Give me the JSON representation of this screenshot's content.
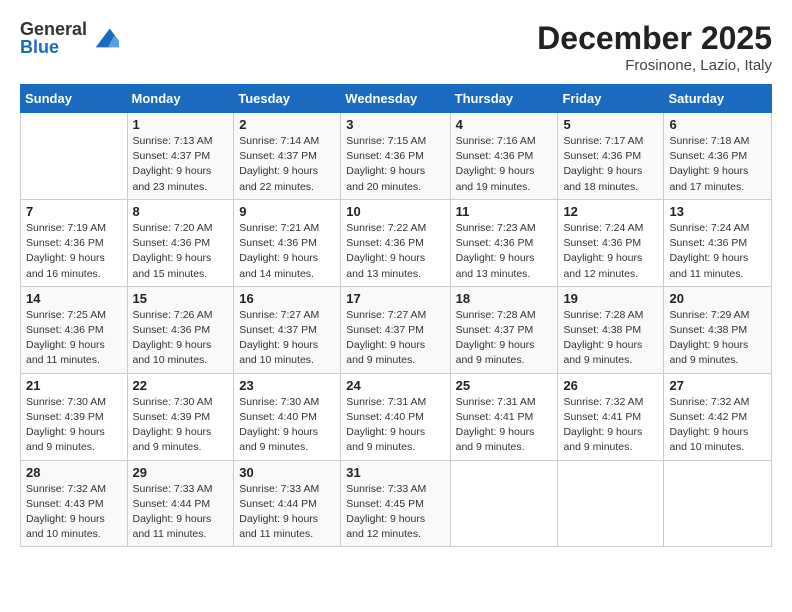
{
  "logo": {
    "general": "General",
    "blue": "Blue"
  },
  "title": "December 2025",
  "location": "Frosinone, Lazio, Italy",
  "days_of_week": [
    "Sunday",
    "Monday",
    "Tuesday",
    "Wednesday",
    "Thursday",
    "Friday",
    "Saturday"
  ],
  "weeks": [
    [
      {
        "day": "",
        "info": ""
      },
      {
        "day": "1",
        "info": "Sunrise: 7:13 AM\nSunset: 4:37 PM\nDaylight: 9 hours\nand 23 minutes."
      },
      {
        "day": "2",
        "info": "Sunrise: 7:14 AM\nSunset: 4:37 PM\nDaylight: 9 hours\nand 22 minutes."
      },
      {
        "day": "3",
        "info": "Sunrise: 7:15 AM\nSunset: 4:36 PM\nDaylight: 9 hours\nand 20 minutes."
      },
      {
        "day": "4",
        "info": "Sunrise: 7:16 AM\nSunset: 4:36 PM\nDaylight: 9 hours\nand 19 minutes."
      },
      {
        "day": "5",
        "info": "Sunrise: 7:17 AM\nSunset: 4:36 PM\nDaylight: 9 hours\nand 18 minutes."
      },
      {
        "day": "6",
        "info": "Sunrise: 7:18 AM\nSunset: 4:36 PM\nDaylight: 9 hours\nand 17 minutes."
      }
    ],
    [
      {
        "day": "7",
        "info": "Sunrise: 7:19 AM\nSunset: 4:36 PM\nDaylight: 9 hours\nand 16 minutes."
      },
      {
        "day": "8",
        "info": "Sunrise: 7:20 AM\nSunset: 4:36 PM\nDaylight: 9 hours\nand 15 minutes."
      },
      {
        "day": "9",
        "info": "Sunrise: 7:21 AM\nSunset: 4:36 PM\nDaylight: 9 hours\nand 14 minutes."
      },
      {
        "day": "10",
        "info": "Sunrise: 7:22 AM\nSunset: 4:36 PM\nDaylight: 9 hours\nand 13 minutes."
      },
      {
        "day": "11",
        "info": "Sunrise: 7:23 AM\nSunset: 4:36 PM\nDaylight: 9 hours\nand 13 minutes."
      },
      {
        "day": "12",
        "info": "Sunrise: 7:24 AM\nSunset: 4:36 PM\nDaylight: 9 hours\nand 12 minutes."
      },
      {
        "day": "13",
        "info": "Sunrise: 7:24 AM\nSunset: 4:36 PM\nDaylight: 9 hours\nand 11 minutes."
      }
    ],
    [
      {
        "day": "14",
        "info": "Sunrise: 7:25 AM\nSunset: 4:36 PM\nDaylight: 9 hours\nand 11 minutes."
      },
      {
        "day": "15",
        "info": "Sunrise: 7:26 AM\nSunset: 4:36 PM\nDaylight: 9 hours\nand 10 minutes."
      },
      {
        "day": "16",
        "info": "Sunrise: 7:27 AM\nSunset: 4:37 PM\nDaylight: 9 hours\nand 10 minutes."
      },
      {
        "day": "17",
        "info": "Sunrise: 7:27 AM\nSunset: 4:37 PM\nDaylight: 9 hours\nand 9 minutes."
      },
      {
        "day": "18",
        "info": "Sunrise: 7:28 AM\nSunset: 4:37 PM\nDaylight: 9 hours\nand 9 minutes."
      },
      {
        "day": "19",
        "info": "Sunrise: 7:28 AM\nSunset: 4:38 PM\nDaylight: 9 hours\nand 9 minutes."
      },
      {
        "day": "20",
        "info": "Sunrise: 7:29 AM\nSunset: 4:38 PM\nDaylight: 9 hours\nand 9 minutes."
      }
    ],
    [
      {
        "day": "21",
        "info": "Sunrise: 7:30 AM\nSunset: 4:39 PM\nDaylight: 9 hours\nand 9 minutes."
      },
      {
        "day": "22",
        "info": "Sunrise: 7:30 AM\nSunset: 4:39 PM\nDaylight: 9 hours\nand 9 minutes."
      },
      {
        "day": "23",
        "info": "Sunrise: 7:30 AM\nSunset: 4:40 PM\nDaylight: 9 hours\nand 9 minutes."
      },
      {
        "day": "24",
        "info": "Sunrise: 7:31 AM\nSunset: 4:40 PM\nDaylight: 9 hours\nand 9 minutes."
      },
      {
        "day": "25",
        "info": "Sunrise: 7:31 AM\nSunset: 4:41 PM\nDaylight: 9 hours\nand 9 minutes."
      },
      {
        "day": "26",
        "info": "Sunrise: 7:32 AM\nSunset: 4:41 PM\nDaylight: 9 hours\nand 9 minutes."
      },
      {
        "day": "27",
        "info": "Sunrise: 7:32 AM\nSunset: 4:42 PM\nDaylight: 9 hours\nand 10 minutes."
      }
    ],
    [
      {
        "day": "28",
        "info": "Sunrise: 7:32 AM\nSunset: 4:43 PM\nDaylight: 9 hours\nand 10 minutes."
      },
      {
        "day": "29",
        "info": "Sunrise: 7:33 AM\nSunset: 4:44 PM\nDaylight: 9 hours\nand 11 minutes."
      },
      {
        "day": "30",
        "info": "Sunrise: 7:33 AM\nSunset: 4:44 PM\nDaylight: 9 hours\nand 11 minutes."
      },
      {
        "day": "31",
        "info": "Sunrise: 7:33 AM\nSunset: 4:45 PM\nDaylight: 9 hours\nand 12 minutes."
      },
      {
        "day": "",
        "info": ""
      },
      {
        "day": "",
        "info": ""
      },
      {
        "day": "",
        "info": ""
      }
    ]
  ]
}
